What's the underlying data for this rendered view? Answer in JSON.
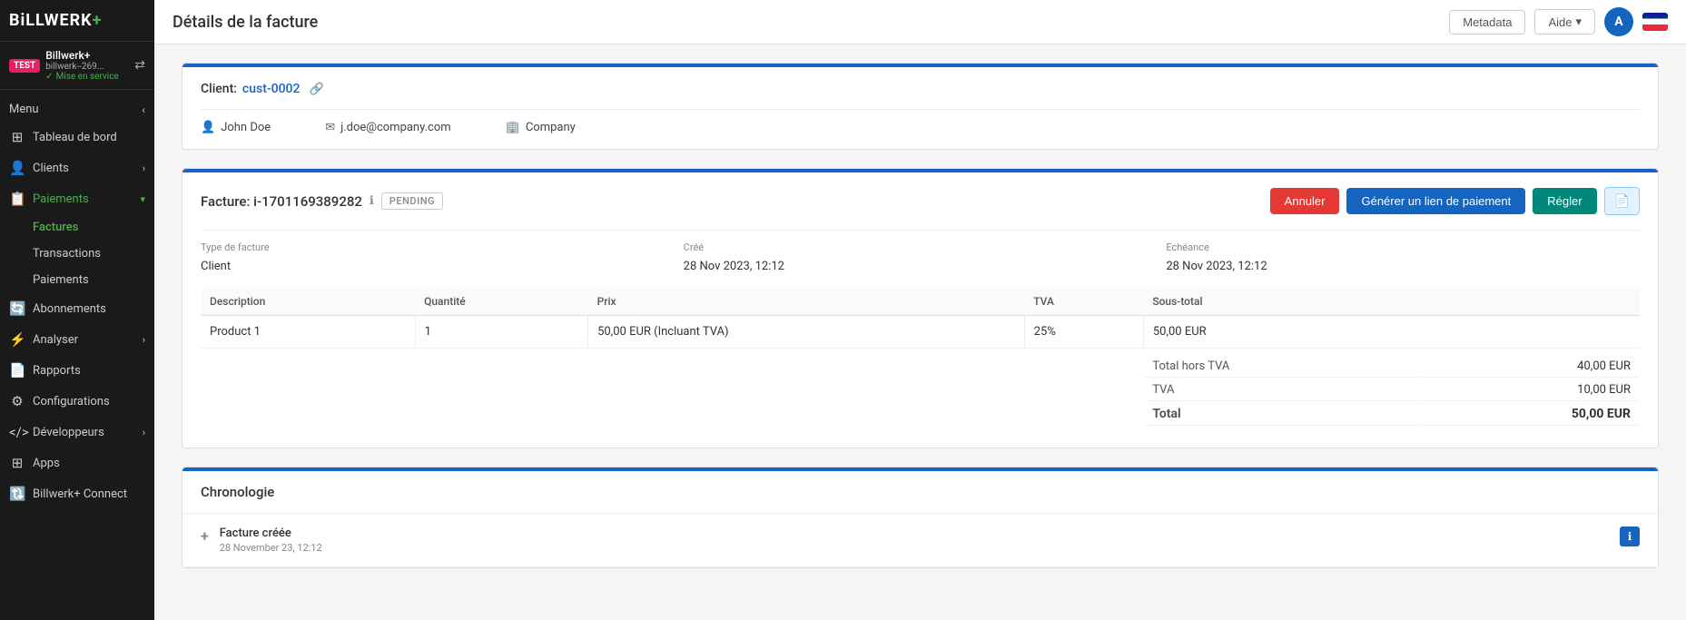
{
  "sidebar": {
    "logo": "BiLLWERK+",
    "logo_plus": "+",
    "test_badge": "TEST",
    "env_name": "Billwerk+",
    "env_sub": "billwerk--269...",
    "mise_en_service": "Mise en service",
    "menu_label": "Menu",
    "items": [
      {
        "id": "tableau-de-bord",
        "label": "Tableau de bord",
        "icon": "⊞",
        "has_arrow": false
      },
      {
        "id": "clients",
        "label": "Clients",
        "icon": "👤",
        "has_arrow": true
      },
      {
        "id": "paiements",
        "label": "Paiements",
        "icon": "📋",
        "has_arrow": true,
        "active": true
      },
      {
        "id": "abonnements",
        "label": "Abonnements",
        "icon": "🔄",
        "has_arrow": false
      },
      {
        "id": "analyser",
        "label": "Analyser",
        "icon": "📈",
        "has_arrow": true
      },
      {
        "id": "rapports",
        "label": "Rapports",
        "icon": "📄",
        "has_arrow": false
      },
      {
        "id": "configurations",
        "label": "Configurations",
        "icon": "⚙",
        "has_arrow": false
      },
      {
        "id": "developpeurs",
        "label": "Développeurs",
        "icon": "<>",
        "has_arrow": true
      },
      {
        "id": "apps",
        "label": "Apps",
        "icon": "⊞",
        "has_arrow": false
      },
      {
        "id": "billwerk-connect",
        "label": "Billwerk+ Connect",
        "icon": "🔃",
        "has_arrow": false
      }
    ],
    "sub_items": [
      {
        "id": "factures",
        "label": "Factures",
        "active": true
      },
      {
        "id": "transactions",
        "label": "Transactions",
        "active": false
      },
      {
        "id": "paiements-sub",
        "label": "Paiements",
        "active": false
      }
    ]
  },
  "topbar": {
    "page_title": "Détails de la facture",
    "btn_metadata": "Metadata",
    "btn_aide": "Aide",
    "user_avatar": "A"
  },
  "client_section": {
    "label": "Client:",
    "client_id": "cust-0002",
    "name": "John Doe",
    "email": "j.doe@company.com",
    "company": "Company"
  },
  "invoice_section": {
    "label": "Facture:",
    "invoice_id": "i-1701169389282",
    "status": "PENDING",
    "btn_annuler": "Annuler",
    "btn_generer": "Générer un lien de paiement",
    "btn_regler": "Régler",
    "meta": {
      "type_label": "Type de facture",
      "type_value": "Client",
      "cree_label": "Créé",
      "cree_value": "28 Nov 2023, 12:12",
      "echeance_label": "Echéance",
      "echeance_value": "28 Nov 2023, 12:12"
    },
    "table": {
      "headers": [
        "Description",
        "Quantité",
        "Prix",
        "TVA",
        "Sous-total"
      ],
      "rows": [
        {
          "description": "Product 1",
          "quantity": "1",
          "price": "50,00 EUR (Incluant TVA)",
          "tva": "25%",
          "subtotal": "50,00 EUR"
        }
      ]
    },
    "totals": {
      "total_hors_tva_label": "Total hors TVA",
      "total_hors_tva_value": "40,00 EUR",
      "tva_label": "TVA",
      "tva_value": "10,00 EUR",
      "total_label": "Total",
      "total_value": "50,00 EUR"
    }
  },
  "chronologie": {
    "title": "Chronologie",
    "items": [
      {
        "title": "Facture créée",
        "date": "28 November 23, 12:12"
      }
    ]
  }
}
